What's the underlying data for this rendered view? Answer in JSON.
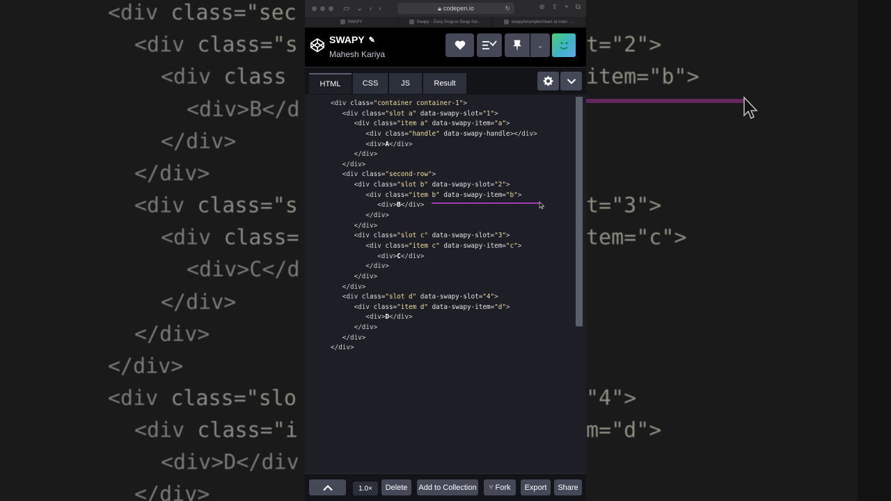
{
  "background": {
    "lines": [
      {
        "t": "<div class=\"sec",
        "parts": [
          [
            "tag",
            "<div "
          ],
          [
            "attr",
            "class="
          ],
          [
            "str",
            "\"sec"
          ]
        ]
      },
      {
        "t": "",
        "parts": [
          [
            "tag",
            "<div "
          ],
          [
            "attr",
            "class="
          ],
          [
            "str",
            "\"s"
          ]
        ]
      },
      {
        "t": "",
        "parts": [
          [
            "tag",
            "<div "
          ],
          [
            "attr",
            "class"
          ]
        ]
      },
      {
        "t": "",
        "parts": [
          [
            "tag",
            "<div>B</d"
          ]
        ]
      },
      {
        "t": "",
        "parts": [
          [
            "tag",
            "</div>"
          ]
        ]
      },
      {
        "t": "",
        "parts": [
          [
            "tag",
            "</div>"
          ]
        ]
      },
      {
        "t": "",
        "parts": [
          [
            "tag",
            "<div "
          ],
          [
            "attr",
            "class="
          ],
          [
            "str",
            "\"s"
          ]
        ]
      },
      {
        "t": "",
        "parts": [
          [
            "tag",
            "<div "
          ],
          [
            "attr",
            "class="
          ]
        ]
      },
      {
        "t": "",
        "parts": [
          [
            "tag",
            "<div>C</d"
          ]
        ]
      },
      {
        "t": "",
        "parts": [
          [
            "tag",
            "</div>"
          ]
        ]
      },
      {
        "t": "",
        "parts": [
          [
            "tag",
            "</div>"
          ]
        ]
      },
      {
        "t": "",
        "parts": [
          [
            "tag",
            "</div>"
          ]
        ]
      },
      {
        "t": "",
        "parts": [
          [
            "tag",
            "<div "
          ],
          [
            "attr",
            "class="
          ],
          [
            "str",
            "\"slo"
          ]
        ]
      },
      {
        "t": "",
        "parts": [
          [
            "tag",
            "<div "
          ],
          [
            "attr",
            "class="
          ],
          [
            "str",
            "\"i"
          ]
        ]
      },
      {
        "t": "",
        "parts": [
          [
            "tag",
            "<div>D</div"
          ]
        ]
      },
      {
        "t": "",
        "parts": [
          [
            "tag",
            "</div>"
          ]
        ]
      }
    ],
    "right_fragments": [
      "t=\"2\">",
      "item=\"b\">",
      "t=\"3\">",
      "tem=\"c\">",
      "\"4\">",
      "m=\"d\">"
    ]
  },
  "browser": {
    "url": "codepen.io",
    "tabs": [
      {
        "label": "SWAPY"
      },
      {
        "label": "Swapy – Easy Drag-to-Swap Sol..."
      },
      {
        "label": "swapy/examples/react at main ·..."
      }
    ]
  },
  "pen": {
    "title": "SWAPY",
    "author": "Mahesh Kariya"
  },
  "editor_tabs": [
    {
      "label": "HTML",
      "active": true
    },
    {
      "label": "CSS",
      "active": false
    },
    {
      "label": "JS",
      "active": false
    },
    {
      "label": "Result",
      "active": false
    }
  ],
  "code_lines": [
    [
      0,
      [
        [
          "tag",
          "<div "
        ],
        [
          "attr",
          "class="
        ],
        [
          "str",
          "\"container container-1\""
        ],
        [
          "tag",
          ">"
        ]
      ]
    ],
    [
      1,
      [
        [
          "tag",
          "<div "
        ],
        [
          "attr",
          "class="
        ],
        [
          "str",
          "\"slot a\""
        ],
        [
          "attr",
          " data-swapy-slot="
        ],
        [
          "str",
          "\"1\""
        ],
        [
          "tag",
          ">"
        ]
      ]
    ],
    [
      2,
      [
        [
          "tag",
          "<div "
        ],
        [
          "attr",
          "class="
        ],
        [
          "str",
          "\"item a\""
        ],
        [
          "attr",
          " data-swapy-item="
        ],
        [
          "str",
          "\"a\""
        ],
        [
          "tag",
          ">"
        ]
      ]
    ],
    [
      3,
      [
        [
          "tag",
          "<div "
        ],
        [
          "attr",
          "class="
        ],
        [
          "str",
          "\"handle\""
        ],
        [
          "attr",
          " data-swapy-handle"
        ],
        [
          "tag",
          "></div>"
        ]
      ]
    ],
    [
      3,
      [
        [
          "tag",
          "<div>"
        ],
        [
          "txt",
          "A"
        ],
        [
          "tag",
          "</div>"
        ]
      ]
    ],
    [
      2,
      [
        [
          "tag",
          "</div>"
        ]
      ]
    ],
    [
      1,
      [
        [
          "tag",
          "</div>"
        ]
      ]
    ],
    [
      1,
      [
        [
          "tag",
          "<div "
        ],
        [
          "attr",
          "class="
        ],
        [
          "str",
          "\"second-row\""
        ],
        [
          "tag",
          ">"
        ]
      ]
    ],
    [
      2,
      [
        [
          "tag",
          "<div "
        ],
        [
          "attr",
          "class="
        ],
        [
          "str",
          "\"slot b\""
        ],
        [
          "attr",
          " data-swapy-slot="
        ],
        [
          "str",
          "\"2\""
        ],
        [
          "tag",
          ">"
        ]
      ]
    ],
    [
      3,
      [
        [
          "tag",
          "<div "
        ],
        [
          "attr",
          "class="
        ],
        [
          "str",
          "\"item b\""
        ],
        [
          "attr",
          " data-swapy-item="
        ],
        [
          "str",
          "\"b\""
        ],
        [
          "tag",
          ">"
        ]
      ]
    ],
    [
      4,
      [
        [
          "tag",
          "<div>"
        ],
        [
          "txt",
          "B"
        ],
        [
          "tag",
          "</div>"
        ]
      ]
    ],
    [
      3,
      [
        [
          "tag",
          "</div>"
        ]
      ]
    ],
    [
      2,
      [
        [
          "tag",
          "</div>"
        ]
      ]
    ],
    [
      2,
      [
        [
          "tag",
          "<div "
        ],
        [
          "attr",
          "class="
        ],
        [
          "str",
          "\"slot c\""
        ],
        [
          "attr",
          " data-swapy-slot="
        ],
        [
          "str",
          "\"3\""
        ],
        [
          "tag",
          ">"
        ]
      ]
    ],
    [
      3,
      [
        [
          "tag",
          "<div "
        ],
        [
          "attr",
          "class="
        ],
        [
          "str",
          "\"item c\""
        ],
        [
          "attr",
          " data-swapy-item="
        ],
        [
          "str",
          "\"c\""
        ],
        [
          "tag",
          ">"
        ]
      ]
    ],
    [
      4,
      [
        [
          "tag",
          "<div>"
        ],
        [
          "txt",
          "C"
        ],
        [
          "tag",
          "</div>"
        ]
      ]
    ],
    [
      3,
      [
        [
          "tag",
          "</div>"
        ]
      ]
    ],
    [
      2,
      [
        [
          "tag",
          "</div>"
        ]
      ]
    ],
    [
      1,
      [
        [
          "tag",
          "</div>"
        ]
      ]
    ],
    [
      1,
      [
        [
          "tag",
          "<div "
        ],
        [
          "attr",
          "class="
        ],
        [
          "str",
          "\"slot d\""
        ],
        [
          "attr",
          " data-swapy-slot="
        ],
        [
          "str",
          "\"4\""
        ],
        [
          "tag",
          ">"
        ]
      ]
    ],
    [
      2,
      [
        [
          "tag",
          "<div "
        ],
        [
          "attr",
          "class="
        ],
        [
          "str",
          "\"item d\""
        ],
        [
          "attr",
          " data-swapy-item="
        ],
        [
          "str",
          "\"d\""
        ],
        [
          "tag",
          ">"
        ]
      ]
    ],
    [
      3,
      [
        [
          "tag",
          "<div>"
        ],
        [
          "txt",
          "D"
        ],
        [
          "tag",
          "</div>"
        ]
      ]
    ],
    [
      2,
      [
        [
          "tag",
          "</div>"
        ]
      ]
    ],
    [
      1,
      [
        [
          "tag",
          "</div>"
        ]
      ]
    ],
    [
      0,
      [
        [
          "tag",
          "</div>"
        ]
      ]
    ]
  ],
  "footer": {
    "zoom": "1.0×",
    "delete": "Delete",
    "add_to_collection": "Add to Collection",
    "fork": "Fork",
    "export": "Export",
    "share": "Share"
  },
  "colors": {
    "accent_purple": "#a03ab0",
    "button_gray": "#444857",
    "editor_bg": "#1e1f26"
  }
}
